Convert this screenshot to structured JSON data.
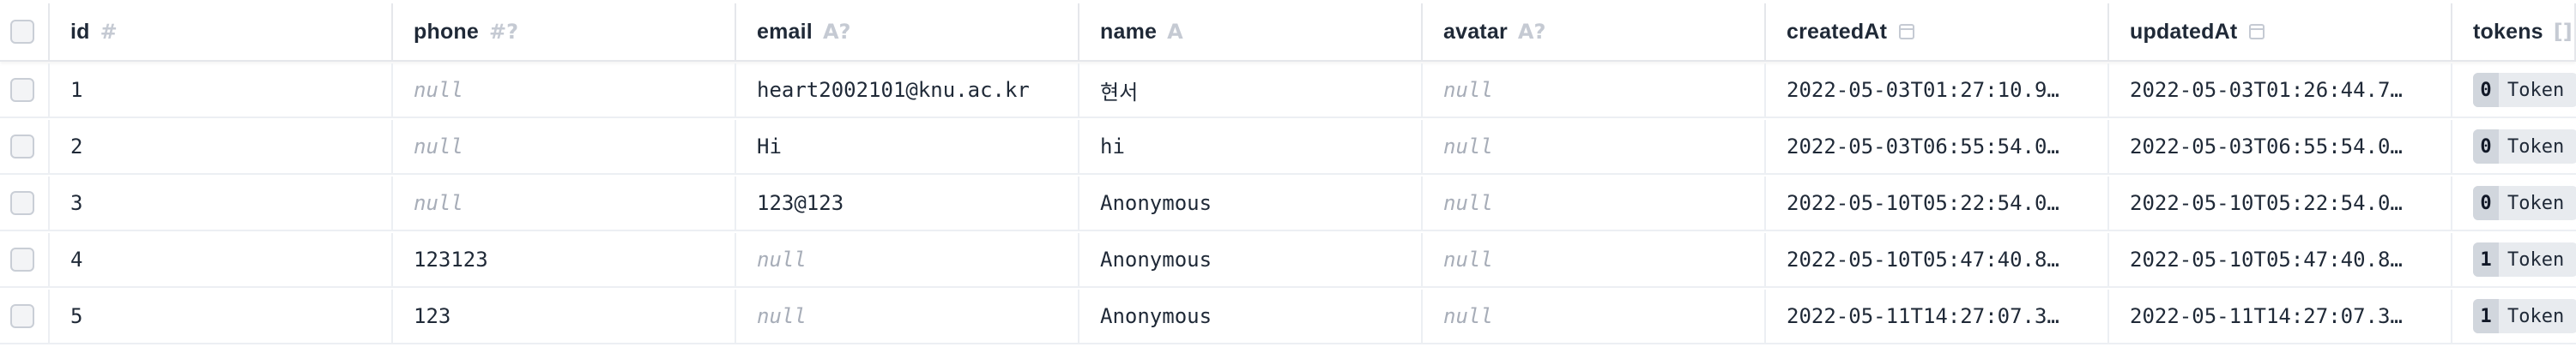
{
  "columns": [
    {
      "key": "id",
      "label": "id",
      "type_icon": "#"
    },
    {
      "key": "phone",
      "label": "phone",
      "type_icon": "#?"
    },
    {
      "key": "email",
      "label": "email",
      "type_icon": "A?"
    },
    {
      "key": "name",
      "label": "name",
      "type_icon": "A"
    },
    {
      "key": "avatar",
      "label": "avatar",
      "type_icon": "A?"
    },
    {
      "key": "createdAt",
      "label": "createdAt",
      "type_icon": "calendar-icon"
    },
    {
      "key": "updatedAt",
      "label": "updatedAt",
      "type_icon": "calendar-icon"
    },
    {
      "key": "tokens",
      "label": "tokens",
      "type_icon": "[]"
    }
  ],
  "null_text": "null",
  "rows": [
    {
      "id": "1",
      "phone": "null",
      "email": "heart2002101@knu.ac.kr",
      "name": "현서",
      "avatar": "null",
      "createdAt": "2022-05-03T01:27:10.9…",
      "updatedAt": "2022-05-03T01:26:44.7…",
      "tokens_count": "0",
      "tokens_label": "Token"
    },
    {
      "id": "2",
      "phone": "null",
      "email": "Hi",
      "name": "hi",
      "avatar": "null",
      "createdAt": "2022-05-03T06:55:54.0…",
      "updatedAt": "2022-05-03T06:55:54.0…",
      "tokens_count": "0",
      "tokens_label": "Token"
    },
    {
      "id": "3",
      "phone": "null",
      "email": "123@123",
      "name": "Anonymous",
      "avatar": "null",
      "createdAt": "2022-05-10T05:22:54.0…",
      "updatedAt": "2022-05-10T05:22:54.0…",
      "tokens_count": "0",
      "tokens_label": "Token"
    },
    {
      "id": "4",
      "phone": "123123",
      "email": "null",
      "name": "Anonymous",
      "avatar": "null",
      "createdAt": "2022-05-10T05:47:40.8…",
      "updatedAt": "2022-05-10T05:47:40.8…",
      "tokens_count": "1",
      "tokens_label": "Token"
    },
    {
      "id": "5",
      "phone": "123",
      "email": "null",
      "name": "Anonymous",
      "avatar": "null",
      "createdAt": "2022-05-11T14:27:07.3…",
      "updatedAt": "2022-05-11T14:27:07.3…",
      "tokens_count": "1",
      "tokens_label": "Token"
    }
  ]
}
